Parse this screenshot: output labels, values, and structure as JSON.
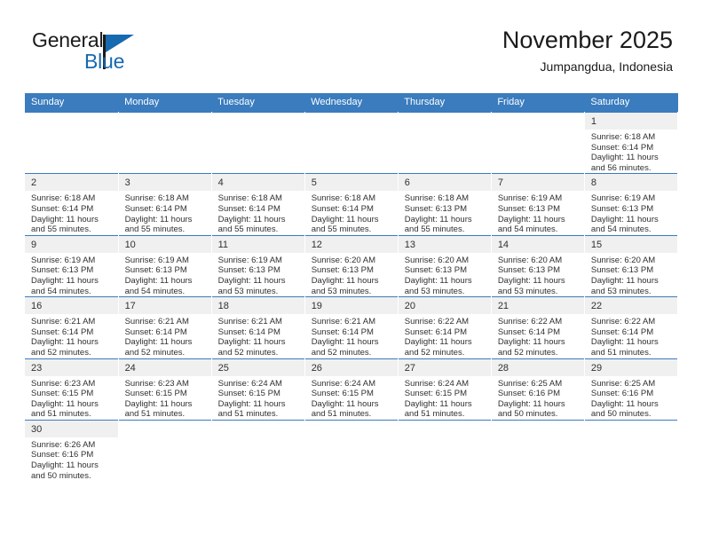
{
  "brand": {
    "name_top": "General",
    "name_bottom": "Blue",
    "logo_icon": "general-blue-flag-logo",
    "color_blue": "#1769b0",
    "color_dark": "#1b1b1b"
  },
  "header": {
    "title": "November 2025",
    "subtitle": "Jumpangdua, Indonesia"
  },
  "calendar": {
    "header_bg": "#3a7cbe",
    "daynum_bg": "#f0f0f0",
    "weekdays": [
      "Sunday",
      "Monday",
      "Tuesday",
      "Wednesday",
      "Thursday",
      "Friday",
      "Saturday"
    ],
    "weeks": [
      [
        {
          "day": "",
          "sunrise": "",
          "sunset": "",
          "daylight": ""
        },
        {
          "day": "",
          "sunrise": "",
          "sunset": "",
          "daylight": ""
        },
        {
          "day": "",
          "sunrise": "",
          "sunset": "",
          "daylight": ""
        },
        {
          "day": "",
          "sunrise": "",
          "sunset": "",
          "daylight": ""
        },
        {
          "day": "",
          "sunrise": "",
          "sunset": "",
          "daylight": ""
        },
        {
          "day": "",
          "sunrise": "",
          "sunset": "",
          "daylight": ""
        },
        {
          "day": "1",
          "sunrise": "Sunrise: 6:18 AM",
          "sunset": "Sunset: 6:14 PM",
          "daylight": "Daylight: 11 hours and 56 minutes."
        }
      ],
      [
        {
          "day": "2",
          "sunrise": "Sunrise: 6:18 AM",
          "sunset": "Sunset: 6:14 PM",
          "daylight": "Daylight: 11 hours and 55 minutes."
        },
        {
          "day": "3",
          "sunrise": "Sunrise: 6:18 AM",
          "sunset": "Sunset: 6:14 PM",
          "daylight": "Daylight: 11 hours and 55 minutes."
        },
        {
          "day": "4",
          "sunrise": "Sunrise: 6:18 AM",
          "sunset": "Sunset: 6:14 PM",
          "daylight": "Daylight: 11 hours and 55 minutes."
        },
        {
          "day": "5",
          "sunrise": "Sunrise: 6:18 AM",
          "sunset": "Sunset: 6:14 PM",
          "daylight": "Daylight: 11 hours and 55 minutes."
        },
        {
          "day": "6",
          "sunrise": "Sunrise: 6:18 AM",
          "sunset": "Sunset: 6:13 PM",
          "daylight": "Daylight: 11 hours and 55 minutes."
        },
        {
          "day": "7",
          "sunrise": "Sunrise: 6:19 AM",
          "sunset": "Sunset: 6:13 PM",
          "daylight": "Daylight: 11 hours and 54 minutes."
        },
        {
          "day": "8",
          "sunrise": "Sunrise: 6:19 AM",
          "sunset": "Sunset: 6:13 PM",
          "daylight": "Daylight: 11 hours and 54 minutes."
        }
      ],
      [
        {
          "day": "9",
          "sunrise": "Sunrise: 6:19 AM",
          "sunset": "Sunset: 6:13 PM",
          "daylight": "Daylight: 11 hours and 54 minutes."
        },
        {
          "day": "10",
          "sunrise": "Sunrise: 6:19 AM",
          "sunset": "Sunset: 6:13 PM",
          "daylight": "Daylight: 11 hours and 54 minutes."
        },
        {
          "day": "11",
          "sunrise": "Sunrise: 6:19 AM",
          "sunset": "Sunset: 6:13 PM",
          "daylight": "Daylight: 11 hours and 53 minutes."
        },
        {
          "day": "12",
          "sunrise": "Sunrise: 6:20 AM",
          "sunset": "Sunset: 6:13 PM",
          "daylight": "Daylight: 11 hours and 53 minutes."
        },
        {
          "day": "13",
          "sunrise": "Sunrise: 6:20 AM",
          "sunset": "Sunset: 6:13 PM",
          "daylight": "Daylight: 11 hours and 53 minutes."
        },
        {
          "day": "14",
          "sunrise": "Sunrise: 6:20 AM",
          "sunset": "Sunset: 6:13 PM",
          "daylight": "Daylight: 11 hours and 53 minutes."
        },
        {
          "day": "15",
          "sunrise": "Sunrise: 6:20 AM",
          "sunset": "Sunset: 6:13 PM",
          "daylight": "Daylight: 11 hours and 53 minutes."
        }
      ],
      [
        {
          "day": "16",
          "sunrise": "Sunrise: 6:21 AM",
          "sunset": "Sunset: 6:14 PM",
          "daylight": "Daylight: 11 hours and 52 minutes."
        },
        {
          "day": "17",
          "sunrise": "Sunrise: 6:21 AM",
          "sunset": "Sunset: 6:14 PM",
          "daylight": "Daylight: 11 hours and 52 minutes."
        },
        {
          "day": "18",
          "sunrise": "Sunrise: 6:21 AM",
          "sunset": "Sunset: 6:14 PM",
          "daylight": "Daylight: 11 hours and 52 minutes."
        },
        {
          "day": "19",
          "sunrise": "Sunrise: 6:21 AM",
          "sunset": "Sunset: 6:14 PM",
          "daylight": "Daylight: 11 hours and 52 minutes."
        },
        {
          "day": "20",
          "sunrise": "Sunrise: 6:22 AM",
          "sunset": "Sunset: 6:14 PM",
          "daylight": "Daylight: 11 hours and 52 minutes."
        },
        {
          "day": "21",
          "sunrise": "Sunrise: 6:22 AM",
          "sunset": "Sunset: 6:14 PM",
          "daylight": "Daylight: 11 hours and 52 minutes."
        },
        {
          "day": "22",
          "sunrise": "Sunrise: 6:22 AM",
          "sunset": "Sunset: 6:14 PM",
          "daylight": "Daylight: 11 hours and 51 minutes."
        }
      ],
      [
        {
          "day": "23",
          "sunrise": "Sunrise: 6:23 AM",
          "sunset": "Sunset: 6:15 PM",
          "daylight": "Daylight: 11 hours and 51 minutes."
        },
        {
          "day": "24",
          "sunrise": "Sunrise: 6:23 AM",
          "sunset": "Sunset: 6:15 PM",
          "daylight": "Daylight: 11 hours and 51 minutes."
        },
        {
          "day": "25",
          "sunrise": "Sunrise: 6:24 AM",
          "sunset": "Sunset: 6:15 PM",
          "daylight": "Daylight: 11 hours and 51 minutes."
        },
        {
          "day": "26",
          "sunrise": "Sunrise: 6:24 AM",
          "sunset": "Sunset: 6:15 PM",
          "daylight": "Daylight: 11 hours and 51 minutes."
        },
        {
          "day": "27",
          "sunrise": "Sunrise: 6:24 AM",
          "sunset": "Sunset: 6:15 PM",
          "daylight": "Daylight: 11 hours and 51 minutes."
        },
        {
          "day": "28",
          "sunrise": "Sunrise: 6:25 AM",
          "sunset": "Sunset: 6:16 PM",
          "daylight": "Daylight: 11 hours and 50 minutes."
        },
        {
          "day": "29",
          "sunrise": "Sunrise: 6:25 AM",
          "sunset": "Sunset: 6:16 PM",
          "daylight": "Daylight: 11 hours and 50 minutes."
        }
      ],
      [
        {
          "day": "30",
          "sunrise": "Sunrise: 6:26 AM",
          "sunset": "Sunset: 6:16 PM",
          "daylight": "Daylight: 11 hours and 50 minutes."
        },
        {
          "day": "",
          "sunrise": "",
          "sunset": "",
          "daylight": ""
        },
        {
          "day": "",
          "sunrise": "",
          "sunset": "",
          "daylight": ""
        },
        {
          "day": "",
          "sunrise": "",
          "sunset": "",
          "daylight": ""
        },
        {
          "day": "",
          "sunrise": "",
          "sunset": "",
          "daylight": ""
        },
        {
          "day": "",
          "sunrise": "",
          "sunset": "",
          "daylight": ""
        },
        {
          "day": "",
          "sunrise": "",
          "sunset": "",
          "daylight": ""
        }
      ]
    ]
  }
}
